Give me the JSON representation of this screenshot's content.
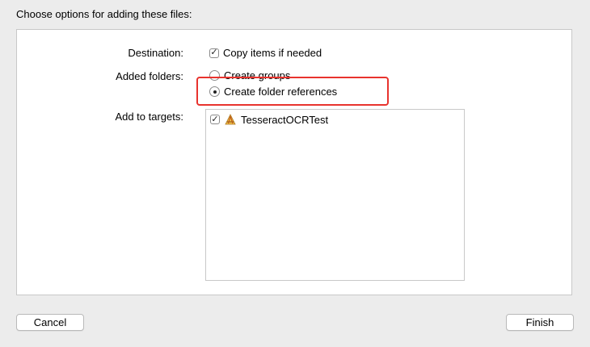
{
  "dialog": {
    "title": "Choose options for adding these files:"
  },
  "options": {
    "destination": {
      "label": "Destination:",
      "checkbox_label": "Copy items if needed",
      "checked": true
    },
    "added_folders": {
      "label": "Added folders:",
      "choices": [
        {
          "label": "Create groups",
          "selected": false
        },
        {
          "label": "Create folder references",
          "selected": true
        }
      ]
    },
    "add_to_targets": {
      "label": "Add to targets:",
      "targets": [
        {
          "name": "TesseractOCRTest",
          "checked": true,
          "icon": "xcode-app-icon"
        }
      ]
    }
  },
  "annotation": {
    "highlight_color": "#e8332e"
  },
  "buttons": {
    "cancel": "Cancel",
    "finish": "Finish"
  },
  "check_glyph": "✓"
}
